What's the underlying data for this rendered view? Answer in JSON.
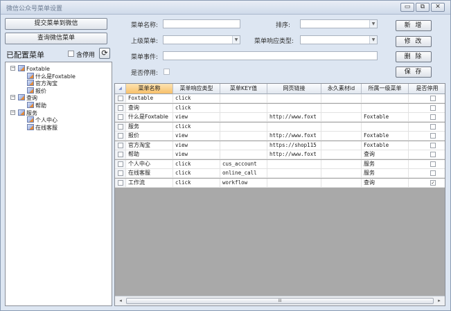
{
  "window": {
    "title": "微信公众号菜单设置",
    "controls": [
      "▭",
      "⧉",
      "✕"
    ]
  },
  "left": {
    "submit_label": "提交菜单到微信",
    "query_label": "查询微信菜单",
    "configured_label": "已配置菜单",
    "disabled_label": "含停用",
    "refresh_glyph": "⟳"
  },
  "tree": [
    {
      "label": "Foxtable",
      "level": 0,
      "expanded": true
    },
    {
      "label": "什么是Foxtable",
      "level": 1
    },
    {
      "label": "官方淘宝",
      "level": 1
    },
    {
      "label": "报价",
      "level": 1
    },
    {
      "label": "查询",
      "level": 0,
      "expanded": true
    },
    {
      "label": "帮助",
      "level": 1
    },
    {
      "label": "服务",
      "level": 0,
      "expanded": true
    },
    {
      "label": "个人中心",
      "level": 1
    },
    {
      "label": "在线客服",
      "level": 1
    }
  ],
  "form": {
    "name_label": "菜单名称:",
    "order_label": "排序:",
    "parent_label": "上级菜单:",
    "type_label": "菜单响应类型:",
    "event_label": "菜单事件:",
    "disabled_label": "是否停用:"
  },
  "actions": {
    "add": "新 增",
    "edit": "修 改",
    "delete": "删 除",
    "save": "保 存"
  },
  "table": {
    "columns": [
      "菜单名称",
      "菜单响应类型",
      "菜单KEY值",
      "网页链接",
      "永久素材id",
      "所属一级菜单",
      "是否停用"
    ],
    "rows": [
      {
        "name": "Foxtable",
        "type": "click",
        "key": "",
        "url": "",
        "media": "",
        "parent": "",
        "disabled": false
      },
      {
        "name": "查询",
        "type": "click",
        "key": "",
        "url": "",
        "media": "",
        "parent": "",
        "disabled": false
      },
      {
        "name": "什么是Foxtable",
        "type": "view",
        "key": "",
        "url": "http://www.foxt",
        "media": "",
        "parent": "Foxtable",
        "disabled": false
      },
      {
        "name": "服务",
        "type": "click",
        "key": "",
        "url": "",
        "media": "",
        "parent": "",
        "disabled": false
      },
      {
        "name": "报价",
        "type": "view",
        "key": "",
        "url": "http://www.foxt",
        "media": "",
        "parent": "Foxtable",
        "disabled": false
      },
      {
        "name": "官方淘宝",
        "type": "view",
        "key": "",
        "url": "https://shop115",
        "media": "",
        "parent": "Foxtable",
        "disabled": false
      },
      {
        "name": "帮助",
        "type": "view",
        "key": "",
        "url": "http://www.foxt",
        "media": "",
        "parent": "查询",
        "disabled": false
      },
      {
        "name": "个人中心",
        "type": "click",
        "key": "cus_account",
        "url": "",
        "media": "",
        "parent": "服务",
        "disabled": false
      },
      {
        "name": "在线客服",
        "type": "click",
        "key": "online_call",
        "url": "",
        "media": "",
        "parent": "服务",
        "disabled": false
      },
      {
        "name": "工作流",
        "type": "click",
        "key": "workflow",
        "url": "",
        "media": "",
        "parent": "查询",
        "disabled": true
      }
    ]
  },
  "scroll": {
    "left": "◂",
    "right": "▸",
    "grip": "III"
  }
}
